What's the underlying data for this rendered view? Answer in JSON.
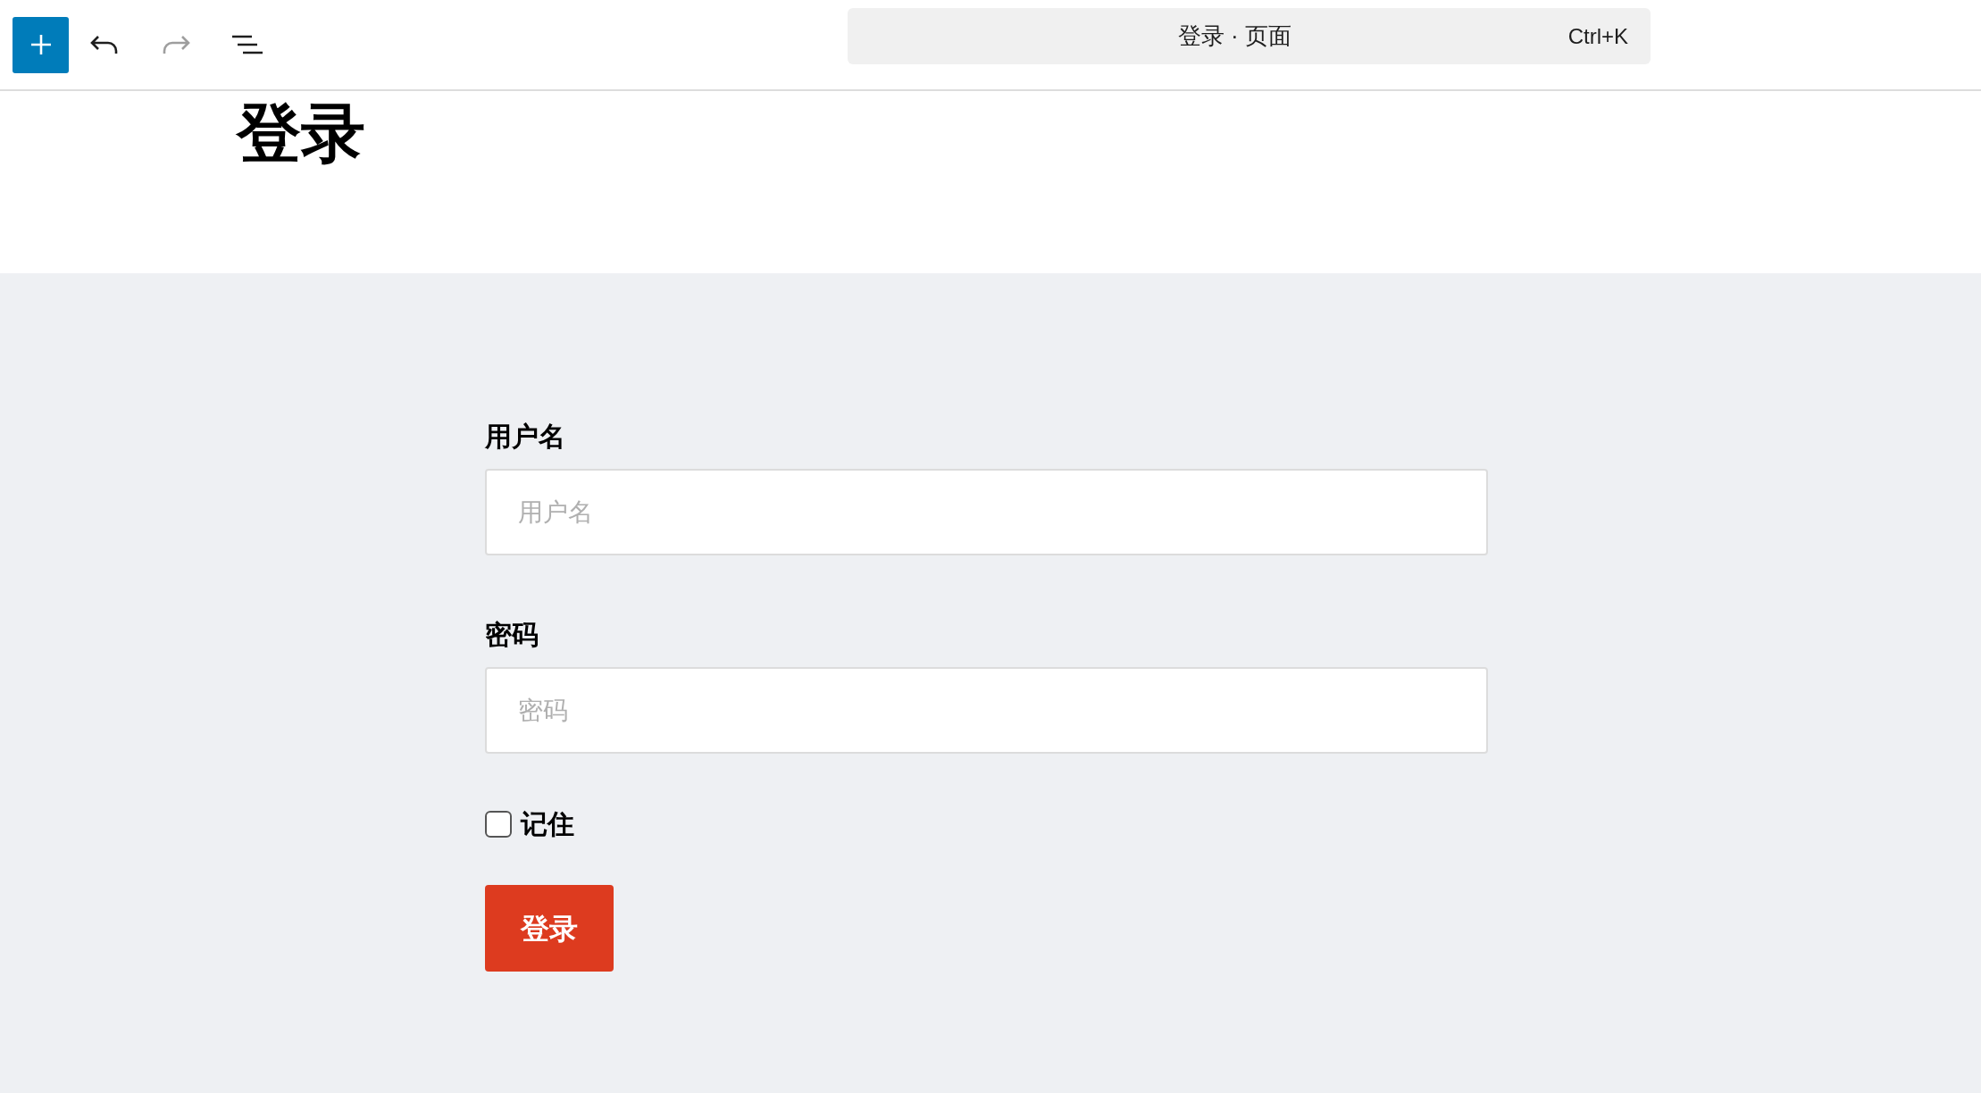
{
  "toolbar": {
    "document_title": "登录 · 页面",
    "shortcut": "Ctrl+K",
    "redo_disabled": true
  },
  "page": {
    "title": "登录"
  },
  "form": {
    "fields": [
      {
        "label": "用户名",
        "placeholder": "用户名"
      },
      {
        "label": "密码",
        "placeholder": "密码"
      }
    ],
    "remember": {
      "label": "记住",
      "checked": false
    },
    "submit": "登录"
  }
}
